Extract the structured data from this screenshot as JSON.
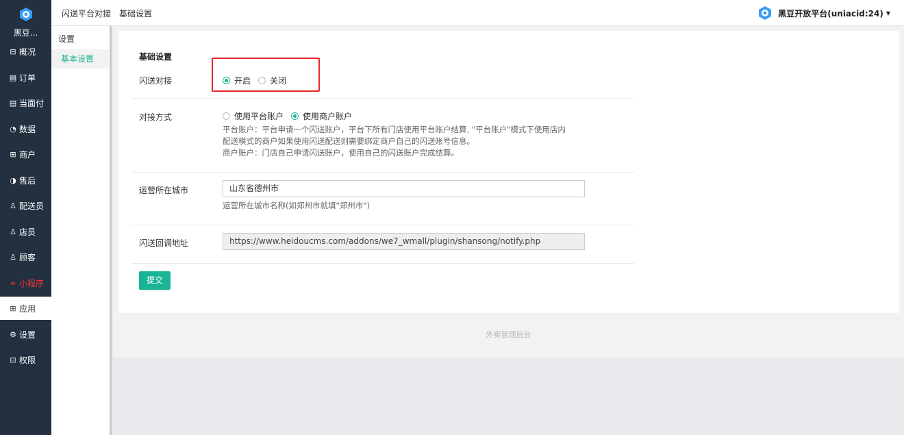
{
  "sidebar": {
    "brand": "黑豆...",
    "items": [
      {
        "label": "概况",
        "icon": "dashboard-icon"
      },
      {
        "label": "订单",
        "icon": "order-icon"
      },
      {
        "label": "当面付",
        "icon": "pay-icon"
      },
      {
        "label": "数据",
        "icon": "data-icon"
      },
      {
        "label": "商户",
        "icon": "store-icon"
      },
      {
        "label": "售后",
        "icon": "after-sale-icon"
      },
      {
        "label": "配送员",
        "icon": "deliveryman-icon"
      },
      {
        "label": "店员",
        "icon": "clerk-icon"
      },
      {
        "label": "顾客",
        "icon": "customer-icon"
      },
      {
        "label": "小程序",
        "icon": "miniprogram-icon"
      },
      {
        "label": "应用",
        "icon": "apps-icon"
      },
      {
        "label": "设置",
        "icon": "gear-icon"
      },
      {
        "label": "权限",
        "icon": "lock-icon"
      }
    ]
  },
  "subsidebar": {
    "title": "设置",
    "item": "基本设置"
  },
  "topbar": {
    "crumb1": "闪送平台对接",
    "crumb2": "基础设置",
    "account": "黑豆开放平台(uniacid:24)"
  },
  "form": {
    "section_title": "基础设置",
    "dock": {
      "label": "闪送对接",
      "on": "开启",
      "off": "关闭",
      "selected": "开启"
    },
    "mode": {
      "label": "对接方式",
      "opt1": "使用平台账户",
      "opt2": "使用商户账户",
      "selected": "使用商户账户",
      "help1": "平台账户：平台申请一个闪送账户，平台下所有门店使用平台账户结算, \"平台账户\"模式下使用店内",
      "help2": "配送模式的商户如果使用闪送配送则需要绑定商户自己的闪送账号信息。",
      "help3": "商户账户：门店自己申请闪送账户，使用自己的闪送账户完成结算。"
    },
    "city": {
      "label": "运营所在城市",
      "value": "山东省德州市",
      "help": "运营所在城市名称(如郑州市就填\"郑州市\")"
    },
    "callback": {
      "label": "闪送回调地址",
      "value": "https://www.heidoucms.com/addons/we7_wmall/plugin/shansong/notify.php"
    },
    "submit": "提交"
  },
  "footer": "外卖管理后台",
  "colors": {
    "accent": "#1ab394",
    "sidebar": "#233040",
    "highlight": "#e8262b"
  }
}
